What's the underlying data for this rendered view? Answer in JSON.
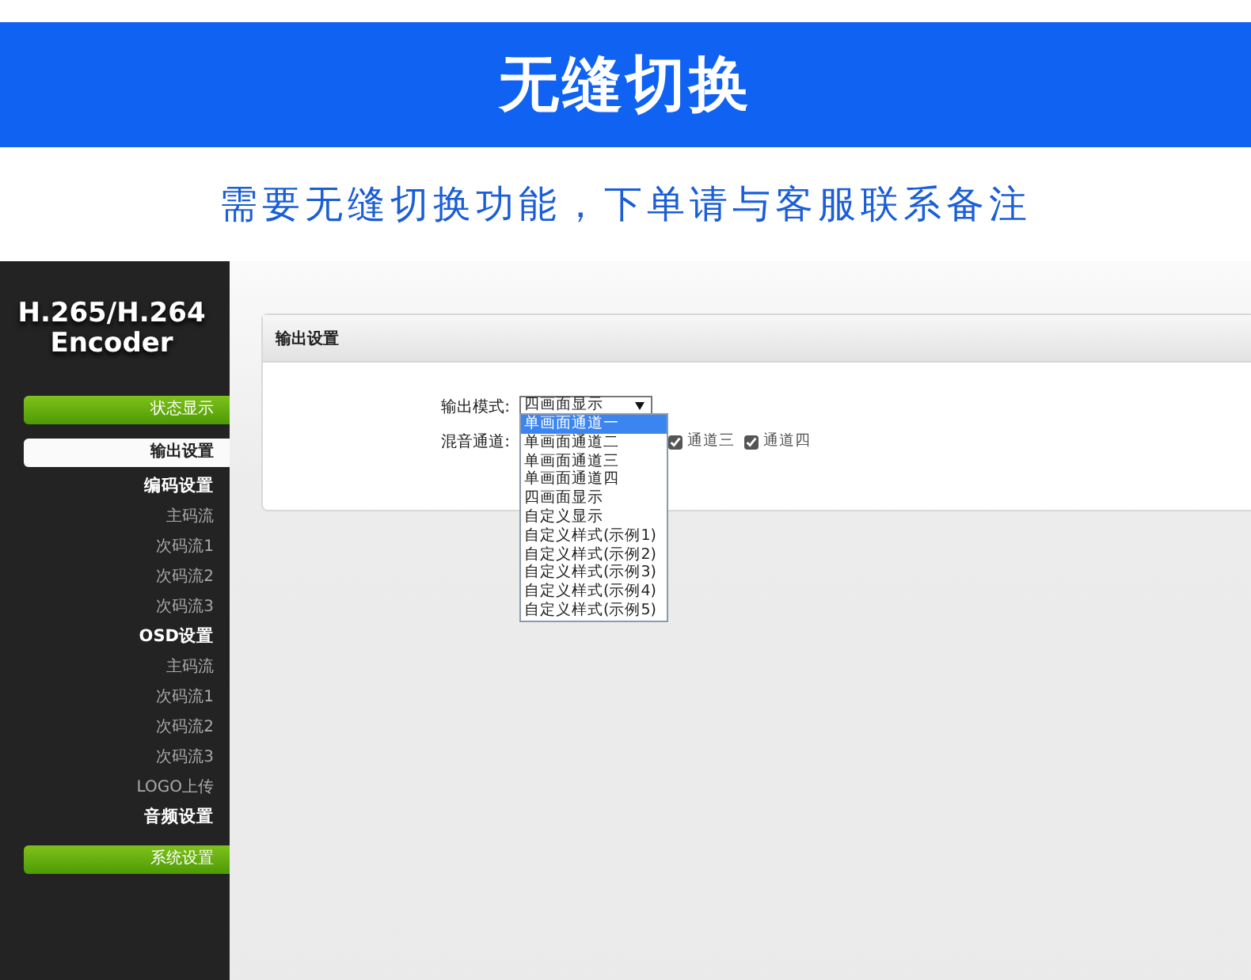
{
  "banner": {
    "title": "无缝切换"
  },
  "notice": "需要无缝切换功能，下单请与客服联系备注",
  "device": {
    "logo": "H.265/H.264 Encoder",
    "sidebar": {
      "items": [
        {
          "label": "状态显示",
          "kind": "button",
          "selected": false
        },
        {
          "label": "输出设置",
          "kind": "page",
          "selected": true
        },
        {
          "label": "编码设置",
          "kind": "heading",
          "selected": false
        },
        {
          "label": "主码流",
          "kind": "sub",
          "selected": false
        },
        {
          "label": "次码流1",
          "kind": "sub",
          "selected": false
        },
        {
          "label": "次码流2",
          "kind": "sub",
          "selected": false
        },
        {
          "label": "次码流3",
          "kind": "sub",
          "selected": false
        },
        {
          "label": "OSD设置",
          "kind": "heading",
          "selected": false
        },
        {
          "label": "主码流",
          "kind": "sub",
          "selected": false
        },
        {
          "label": "次码流1",
          "kind": "sub",
          "selected": false
        },
        {
          "label": "次码流2",
          "kind": "sub",
          "selected": false
        },
        {
          "label": "次码流3",
          "kind": "sub",
          "selected": false
        },
        {
          "label": "LOGO上传",
          "kind": "sub",
          "selected": false
        },
        {
          "label": "音频设置",
          "kind": "heading",
          "selected": false
        },
        {
          "label": "系统设置",
          "kind": "button",
          "selected": false
        }
      ]
    },
    "panel": {
      "title": "输出设置",
      "output_mode": {
        "label": "输出模式:",
        "value": "四画面显示",
        "expanded": true,
        "options": [
          {
            "label": "单画面通道一",
            "highlighted": true
          },
          {
            "label": "单画面通道二",
            "highlighted": false
          },
          {
            "label": "单画面通道三",
            "highlighted": false
          },
          {
            "label": "单画面通道四",
            "highlighted": false
          },
          {
            "label": "四画面显示",
            "highlighted": false
          },
          {
            "label": "自定义显示",
            "highlighted": false
          },
          {
            "label": "自定义样式(示例1)",
            "highlighted": false
          },
          {
            "label": "自定义样式(示例2)",
            "highlighted": false
          },
          {
            "label": "自定义样式(示例3)",
            "highlighted": false
          },
          {
            "label": "自定义样式(示例4)",
            "highlighted": false
          },
          {
            "label": "自定义样式(示例5)",
            "highlighted": false
          }
        ]
      },
      "audio_mix": {
        "label": "混音通道:",
        "channels": [
          {
            "label": "通道三",
            "checked": true
          },
          {
            "label": "通道四",
            "checked": true
          }
        ]
      }
    }
  }
}
